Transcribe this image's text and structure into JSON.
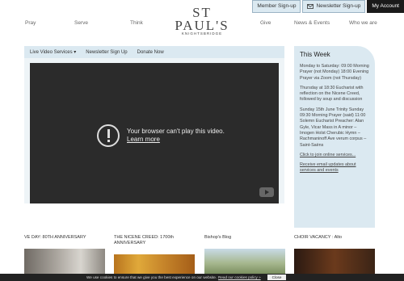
{
  "header": {
    "member_signup": "Member Sign-up",
    "newsletter_signup": "Newsletter Sign-up",
    "my_account": "My Account"
  },
  "logo": {
    "line1": "ST",
    "line2": "PAUL'S",
    "line3": "KNIGHTSBRIDGE"
  },
  "nav": {
    "pray": "Pray",
    "serve": "Serve",
    "think": "Think",
    "give": "Give",
    "news": "News & Events",
    "who": "Who we are"
  },
  "subnav": {
    "live": "Live Video Services",
    "newsletter": "Newsletter Sign Up",
    "donate": "Donate Now"
  },
  "video": {
    "error": "Your browser can't play this video.",
    "learn_more": "Learn more"
  },
  "week": {
    "title": "This Week",
    "p1": "Monday to Saturday: 09:00 Morning Prayer (not Monday) 18:00 Evening Prayer via Zoom (not Thursday)",
    "p2": "Thursday at 18:30 Eucharist with reflection on the Nicene Creed, followed by soup and discussion",
    "p3": "Sunday 15th June Trinity Sunday 09:30 Morning Prayer (said) 11:00 Solemn Eucharist Preacher: Alan Gyle, Vicar Mass in A minor – Imogen Holst Cherubic Hymn – Rachmaninoff Ave verum corpus – Saint-Saëns",
    "link1": "Click to join online services...",
    "link2": "Receive email updates about services and events"
  },
  "tiles": {
    "t1": "VE DAY: 80TH ANNIVERSARY",
    "t2": "THE NICENE CREED: 1700th ANNIVERSARY",
    "t3": "Bishop's Blog",
    "t4": "CHOIR VACANCY : Alto"
  },
  "cookie": {
    "msg": "We use cookies to ensure that we give you the best experience on our website.",
    "link": "Read our cookies policy »",
    "close": "Close"
  }
}
